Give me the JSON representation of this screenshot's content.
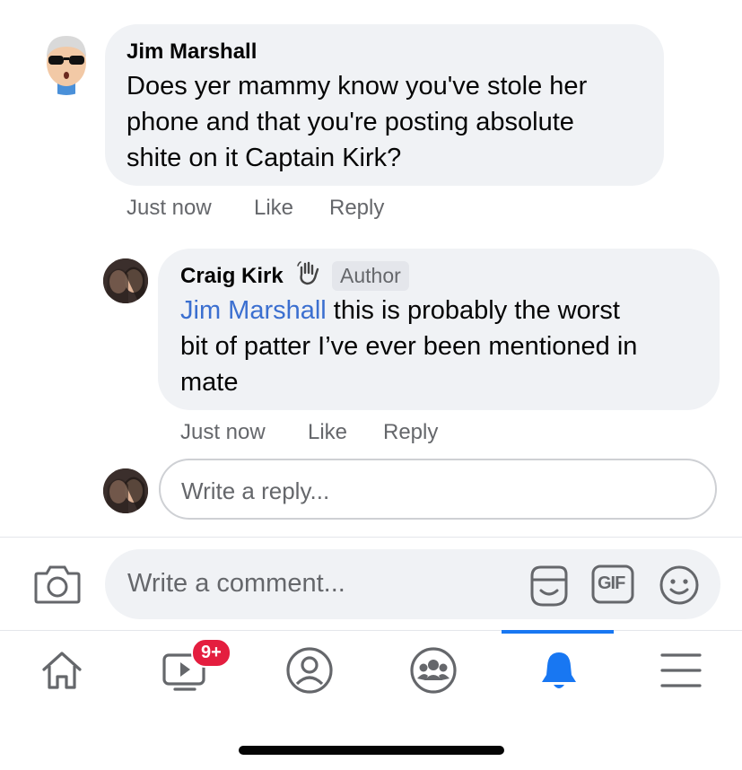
{
  "comment": {
    "author": "Jim Marshall",
    "text": "Does yer mammy know you've stole her phone and that you're posting absolute shite on it Captain Kirk?",
    "text_lines": [
      "Does yer mammy know you've stole her",
      "phone and that you're posting absolute",
      "shite on it Captain Kirk?"
    ],
    "time": "Just now",
    "like_label": "Like",
    "reply_label": "Reply",
    "avatar_icon": "cartoon-avatar-sunglasses"
  },
  "reply": {
    "author": "Craig Kirk",
    "author_badge": "Author",
    "wave_icon": "waving-hand-icon",
    "mention": "Jim Marshall",
    "text_line1_rest": " this is probably the worst",
    "text_line2": "bit of patter I’ve ever been mentioned in",
    "text_line3": "mate",
    "time": "Just now",
    "like_label": "Like",
    "reply_label": "Reply"
  },
  "reply_input": {
    "placeholder": "Write a reply..."
  },
  "comment_input": {
    "placeholder": "Write a comment...",
    "gif_label": "GIF"
  },
  "bottom_nav": {
    "video_badge": "9+",
    "active_tab": "notifications",
    "items": [
      "home",
      "video",
      "profile",
      "groups",
      "notifications",
      "menu"
    ]
  },
  "colors": {
    "accent": "#1877f2",
    "mention": "#3b6fd0",
    "badge": "#e41e3f",
    "bubble": "#f0f2f5",
    "secondary_text": "#65676b"
  }
}
